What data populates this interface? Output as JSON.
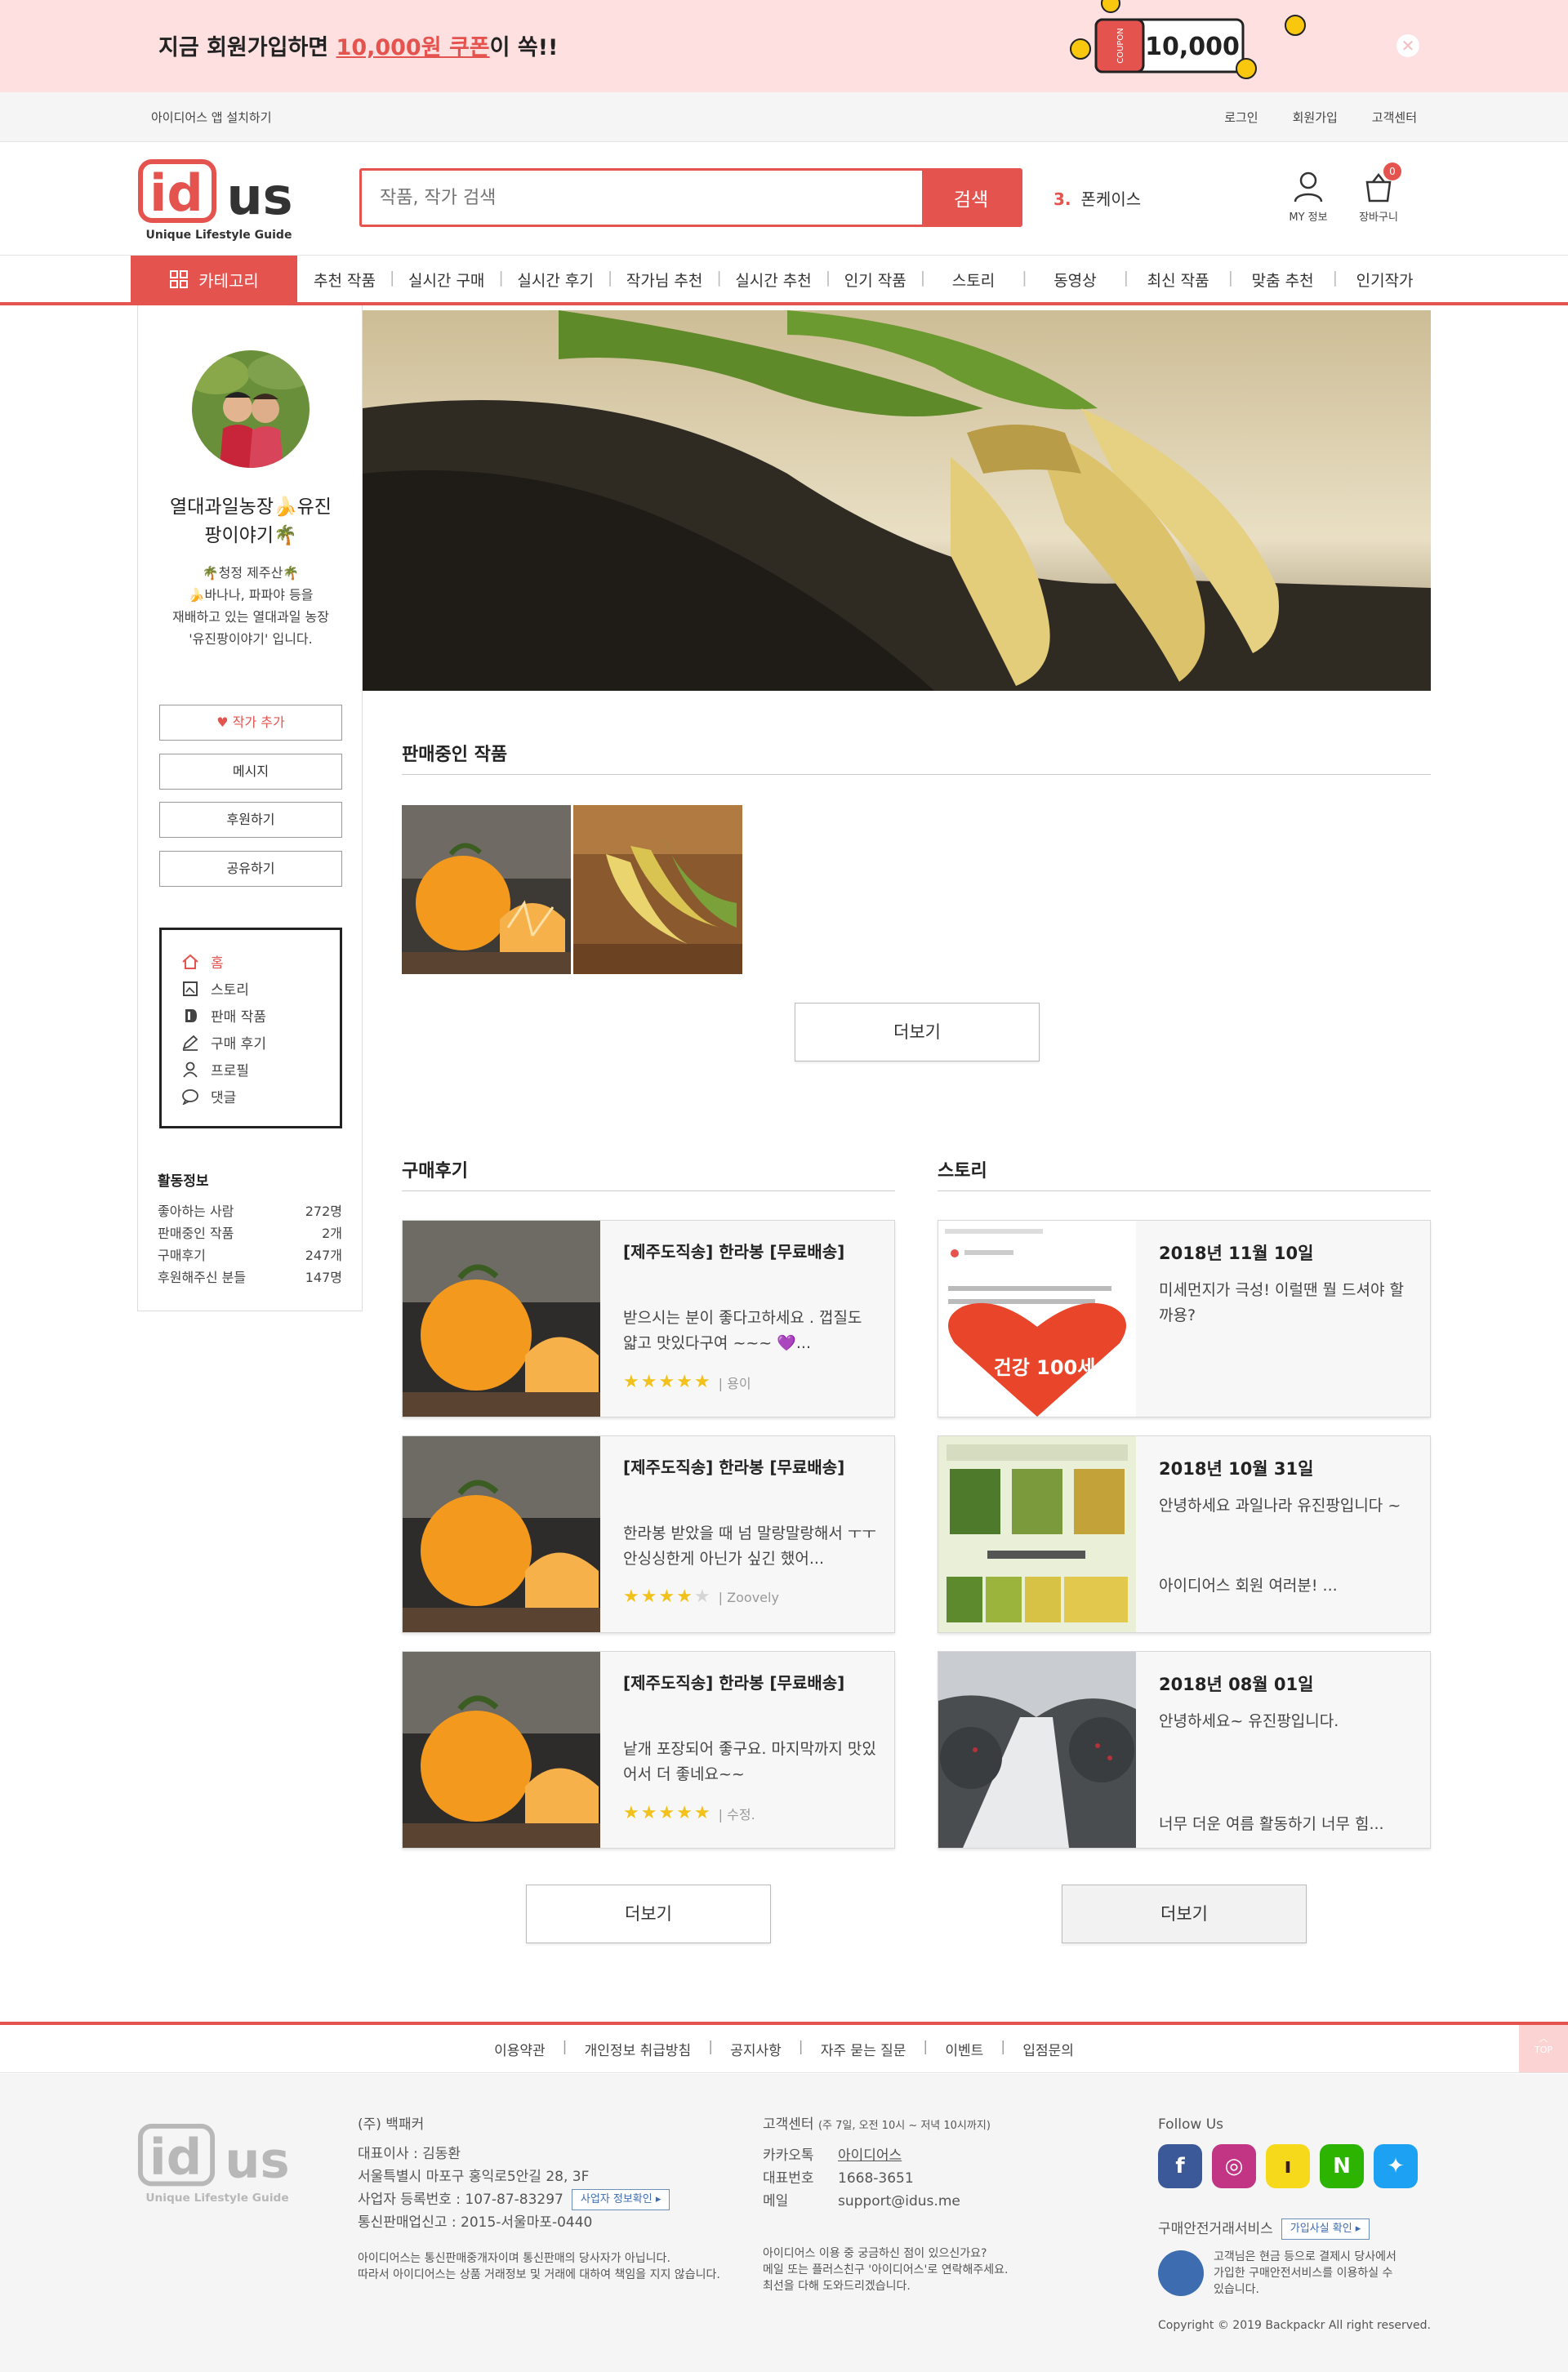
{
  "promo": {
    "text_before": "지금 회원가입하면 ",
    "highlight": "10,000원 쿠폰",
    "text_after": "이 쏙!!",
    "coupon_label": "COUPON",
    "coupon_amount": "10,000",
    "close_icon": "close-icon"
  },
  "util": {
    "app_install": "아이디어스 앱 설치하기",
    "login": "로그인",
    "signup": "회원가입",
    "support": "고객센터"
  },
  "header": {
    "logo_text": "idus",
    "logo_tagline": "Unique Lifestyle Guide",
    "search_placeholder": "작품, 작가 검색",
    "search_button": "검색",
    "trend_rank": "3.",
    "trend_keyword": "폰케이스",
    "my_info": "MY 정보",
    "cart": "장바구니",
    "cart_count": "0"
  },
  "nav": {
    "category": "카테고리",
    "items": [
      "추천 작품",
      "실시간 구매",
      "실시간 후기",
      "작가님 추천",
      "실시간 추천",
      "인기 작품",
      "스토리",
      "동영상",
      "최신 작품",
      "맞춤 추천",
      "인기작가"
    ]
  },
  "sidebar": {
    "name_line1": "열대과일농장🍌유진",
    "name_line2": "팡이야기🌴",
    "desc_line1": "🌴청정 제주산🌴",
    "desc_line2": "🍌바나나, 파파야 등을",
    "desc_line3": "재배하고 있는 열대과일 농장",
    "desc_line4": "'유진팡이야기' 입니다.",
    "buttons": {
      "follow": "작가 추가",
      "message": "메시지",
      "sponsor": "후원하기",
      "share": "공유하기"
    },
    "menu": [
      "홈",
      "스토리",
      "판매 작품",
      "구매 후기",
      "프로필",
      "댓글"
    ],
    "activity_title": "활동정보",
    "activity": [
      {
        "label": "좋아하는 사람",
        "value": "272명"
      },
      {
        "label": "판매중인 작품",
        "value": "2개"
      },
      {
        "label": "구매후기",
        "value": "247개"
      },
      {
        "label": "후원해주신 분들",
        "value": "147명"
      }
    ]
  },
  "products": {
    "title": "판매중인 작품",
    "more": "더보기"
  },
  "reviews": {
    "title": "구매후기",
    "more": "더보기",
    "items": [
      {
        "title": "[제주도직송] 한라봉 [무료배송]",
        "body": "받으시는 분이 좋다고하세요 . 껍질도 얇고 맛있다구여 ~~~ 💜...",
        "rating": 5,
        "author": "| 용이"
      },
      {
        "title": "[제주도직송] 한라봉 [무료배송]",
        "body": "한라봉 받았을 때 넘 말랑말랑해서 ㅜㅜ 안싱싱한게 아닌가 싶긴 했어...",
        "rating": 4,
        "author": "| Zoovely"
      },
      {
        "title": "[제주도직송] 한라봉 [무료배송]",
        "body": "낱개 포장되어 좋구요. 마지막까지 맛있어서 더 좋네요~~",
        "rating": 5,
        "author": "| 수정."
      }
    ]
  },
  "stories": {
    "title": "스토리",
    "more": "더보기",
    "items": [
      {
        "date": "2018년 11월 10일",
        "body": "미세먼지가 극성! 이럴땐 뭘 드셔야 할까용?",
        "extra": ""
      },
      {
        "date": "2018년 10월 31일",
        "body": "안녕하세요 과일나라 유진팡입니다 ~",
        "extra": "아이디어스 회원 여러분! ..."
      },
      {
        "date": "2018년 08월 01일",
        "body": "안녕하세요~ 유진팡입니다.",
        "extra": "너무 더운 여름 활동하기 너무 힘..."
      }
    ],
    "story1_thumb_text": "건강 100세"
  },
  "footer": {
    "links": [
      "이용약관",
      "개인정보 취급방침",
      "공지사항",
      "자주 묻는 질문",
      "이벤트",
      "입점문의"
    ],
    "top": "TOP",
    "company": "(주) 백패커",
    "ceo": "대표이사 : 김동환",
    "address": "서울특별시 마포구 홍익로5안길 28, 3F",
    "biz_no": "사업자 등록번호 : 107-87-83297",
    "biz_btn": "사업자 정보확인 ▸",
    "ecommerce": "통신판매업신고 : 2015-서울마포-0440",
    "disclaimer1": "아이디어스는 통신판매중개자이며 통신판매의 당사자가 아닙니다.",
    "disclaimer2": "따라서 아이디어스는 상품 거래정보 및 거래에 대하여 책임을 지지 않습니다.",
    "cs_title": "고객센터",
    "cs_hours": "(주 7일, 오전 10시 ~ 저녁 10시까지)",
    "kakao_label": "카카오톡",
    "kakao_value": "아이디어스",
    "phone_label": "대표번호",
    "phone_value": "1668-3651",
    "email_label": "메일",
    "email_value": "support@idus.me",
    "cs_note1": "아이디어스 이용 중 궁금하신 점이 있으신가요?",
    "cs_note2": "메일 또는 플러스친구 '아이디어스'로 연락해주세요.",
    "cs_note3": "최선을 다해 도와드리겠습니다.",
    "follow_us": "Follow Us",
    "safe_title": "구매안전거래서비스",
    "safe_btn": "가입사실 확인 ▸",
    "safe_desc1": "고객님은 현금 등으로 결제시 당사에서",
    "safe_desc2": "가입한 구매안전서비스를 이용하실 수",
    "safe_desc3": "있습니다.",
    "copyright": "Copyright © 2019 Backpackr All right reserved."
  }
}
